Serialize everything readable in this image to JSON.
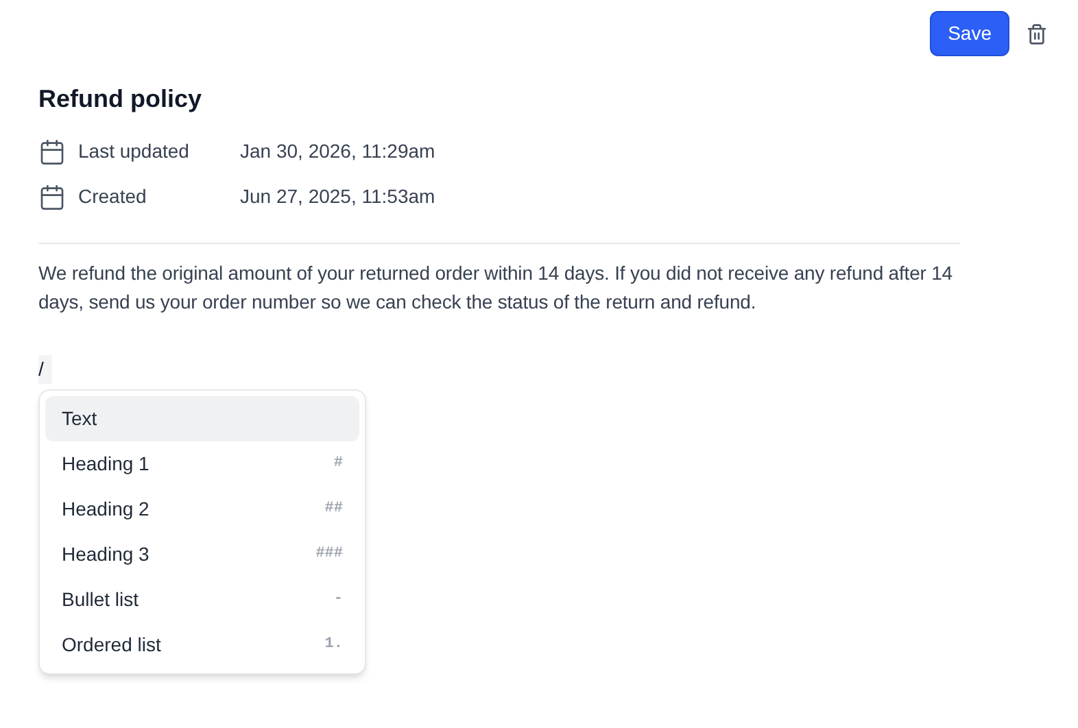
{
  "toolbar": {
    "save_button": "Save"
  },
  "page": {
    "title": "Refund policy",
    "meta": [
      {
        "label": "Last updated",
        "value": "Jan 30, 2026, 11:29am"
      },
      {
        "label": "Created",
        "value": "Jun 27, 2025, 11:53am"
      }
    ],
    "body": "We refund the original amount of your returned order within 14 days. If you did not receive any refund after 14 days, send us your order number so we can check the status of the return and refund.",
    "command_input": "/"
  },
  "block_menu": {
    "items": [
      {
        "label": "Text",
        "selected": true
      },
      {
        "label": "Heading 1",
        "shortcut": "#",
        "selected": false
      },
      {
        "label": "Heading 2",
        "shortcut": "##",
        "selected": false
      },
      {
        "label": "Heading 3",
        "shortcut": "###",
        "selected": false
      },
      {
        "label": "Bullet list",
        "shortcut": "-",
        "selected": false
      },
      {
        "label": "Ordered list",
        "shortcut": "1.",
        "selected": false
      }
    ]
  }
}
